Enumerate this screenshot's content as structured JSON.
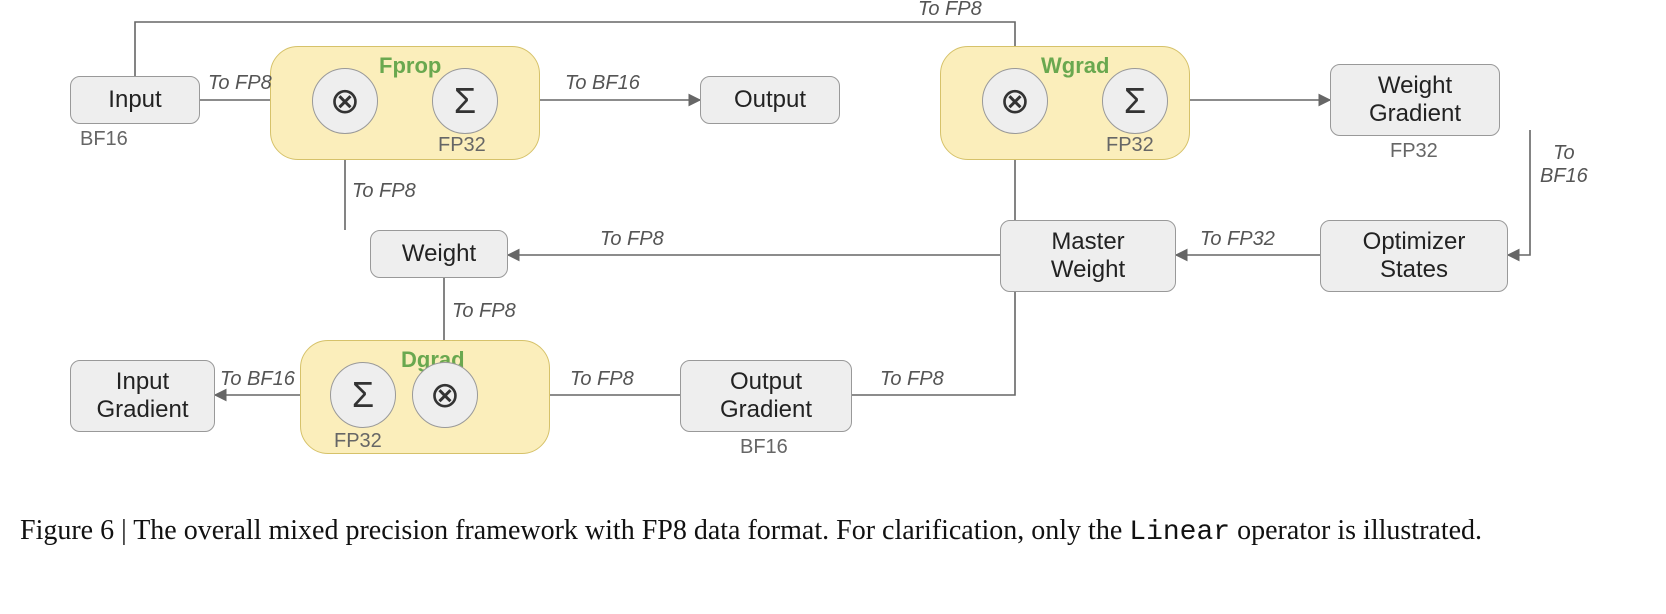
{
  "chart_data": {
    "type": "flow-diagram",
    "nodes": [
      {
        "id": "input",
        "label": "Input",
        "dtype": "BF16"
      },
      {
        "id": "fprop",
        "label": "Fprop",
        "kind": "op-group",
        "ops": [
          "matmul",
          "sum"
        ],
        "accumulator": "FP32"
      },
      {
        "id": "output",
        "label": "Output"
      },
      {
        "id": "wgrad",
        "label": "Wgrad",
        "kind": "op-group",
        "ops": [
          "matmul",
          "sum"
        ],
        "accumulator": "FP32"
      },
      {
        "id": "weight_gradient",
        "label": "Weight Gradient",
        "dtype": "FP32"
      },
      {
        "id": "optimizer_states",
        "label": "Optimizer States"
      },
      {
        "id": "master_weight",
        "label": "Master Weight"
      },
      {
        "id": "weight",
        "label": "Weight"
      },
      {
        "id": "dgrad",
        "label": "Dgrad",
        "kind": "op-group",
        "ops": [
          "matmul",
          "sum"
        ],
        "accumulator": "FP32"
      },
      {
        "id": "output_gradient",
        "label": "Output Gradient",
        "dtype": "BF16"
      },
      {
        "id": "input_gradient",
        "label": "Input Gradient"
      }
    ],
    "edges": [
      {
        "from": "input",
        "to": "fprop",
        "label": "To FP8"
      },
      {
        "from": "weight",
        "to": "fprop",
        "label": "To FP8"
      },
      {
        "from": "fprop",
        "to": "output",
        "label": "To BF16"
      },
      {
        "from": "input",
        "to": "wgrad",
        "label": "To FP8"
      },
      {
        "from": "output_gradient",
        "to": "wgrad",
        "label": "To FP8"
      },
      {
        "from": "wgrad",
        "to": "weight_gradient"
      },
      {
        "from": "weight_gradient",
        "to": "optimizer_states",
        "label": "To BF16"
      },
      {
        "from": "optimizer_states",
        "to": "master_weight",
        "label": "To FP32"
      },
      {
        "from": "master_weight",
        "to": "weight",
        "label": "To FP8"
      },
      {
        "from": "weight",
        "to": "dgrad",
        "label": "To FP8"
      },
      {
        "from": "output_gradient",
        "to": "dgrad",
        "label": "To FP8"
      },
      {
        "from": "dgrad",
        "to": "input_gradient",
        "label": "To BF16"
      }
    ]
  },
  "labels": {
    "input": "Input",
    "output": "Output",
    "weight": "Weight",
    "master_weight": "Master\nWeight",
    "optimizer_states": "Optimizer\nStates",
    "weight_gradient": "Weight\nGradient",
    "output_gradient": "Output\nGradient",
    "input_gradient": "Input\nGradient",
    "fprop_title": "Fprop",
    "wgrad_title": "Wgrad",
    "dgrad_title": "Dgrad",
    "sum_glyph": "Σ",
    "mul_glyph": "⊗",
    "fp32": "FP32",
    "bf16": "BF16"
  },
  "edge_labels": {
    "to_fp8": "To FP8",
    "to_bf16": "To BF16",
    "to_fp32": "To FP32",
    "to_bf16_multiline": "To\nBF16"
  },
  "caption": {
    "prefix": "Figure 6 | The overall mixed precision framework with FP8 data format. For clarification, only the ",
    "mono": "Linear",
    "suffix": " operator is illustrated."
  }
}
